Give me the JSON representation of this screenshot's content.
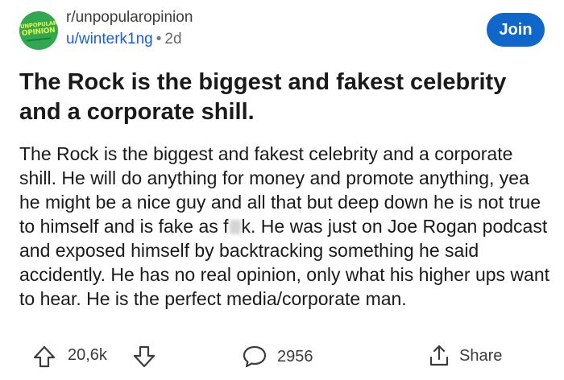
{
  "header": {
    "avatar_line1": "UNPOPULAR",
    "avatar_line2": "OPINION",
    "subreddit": "r/unpopularopinion",
    "username": "u/winterk1ng",
    "separator": "•",
    "age": "2d",
    "join_label": "Join"
  },
  "post": {
    "title": "The Rock is the biggest and fakest celebrity and a corporate shill.",
    "body_part1": "The Rock is the biggest and fakest celebrity and a corporate shill. He will do anything for money and promote anything, yea he might be a nice guy and all that but deep down he is not true to himself and is fake as f",
    "body_part2": "k. He was just on Joe Rogan podcast and exposed himself by backtracking something he said accidently. He has no real opinion, only what his higher ups want to hear. He is the perfect media/corporate man."
  },
  "actions": {
    "upvote_icon": "arrow-up-icon",
    "vote_count": "20,6k",
    "downvote_icon": "arrow-down-icon",
    "comment_icon": "comment-bubble-icon",
    "comment_count": "2956",
    "share_icon": "share-icon",
    "share_label": "Share"
  },
  "colors": {
    "accent": "#0f67c9",
    "username": "#1a5fd6",
    "avatar_bg": "#2fa84f",
    "avatar_text": "#e9f04a"
  }
}
